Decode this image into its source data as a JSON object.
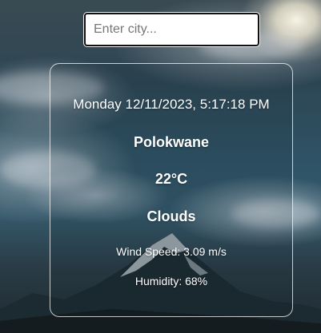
{
  "search": {
    "placeholder": "Enter city...",
    "value": ""
  },
  "weather": {
    "datetime": "Monday 12/11/2023,  5:17:18 PM",
    "city": "Polokwane",
    "temperature": "22°C",
    "condition": "Clouds",
    "wind": "Wind Speed: 3.09 m/s",
    "humidity": "Humidity: 68%"
  }
}
